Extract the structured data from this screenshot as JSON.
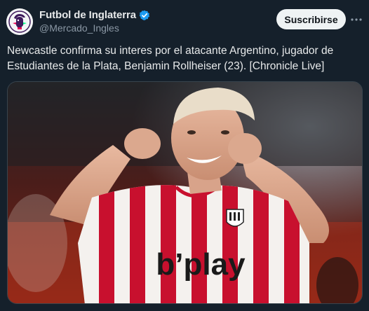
{
  "post": {
    "display_name": "Futbol de Inglaterra",
    "handle": "@Mercado_Ingles",
    "subscribe_label": "Suscribirse",
    "text": "Newcastle confirma su interes por el atacante Argentino, jugador de\nEstudiantes de la Plata, Benjamin Rollheiser (23). [Chronicle Live]",
    "media": {
      "jersey_sponsor": "b’play"
    }
  },
  "icons": {
    "avatar": "premier-league-lion-logo",
    "verified": "verified-badge-icon",
    "more": "more-options-icon"
  },
  "colors": {
    "background": "#15202b",
    "verified_blue": "#1d9bf0",
    "button_bg": "#eff3f4",
    "jersey_red": "#c8102e"
  }
}
